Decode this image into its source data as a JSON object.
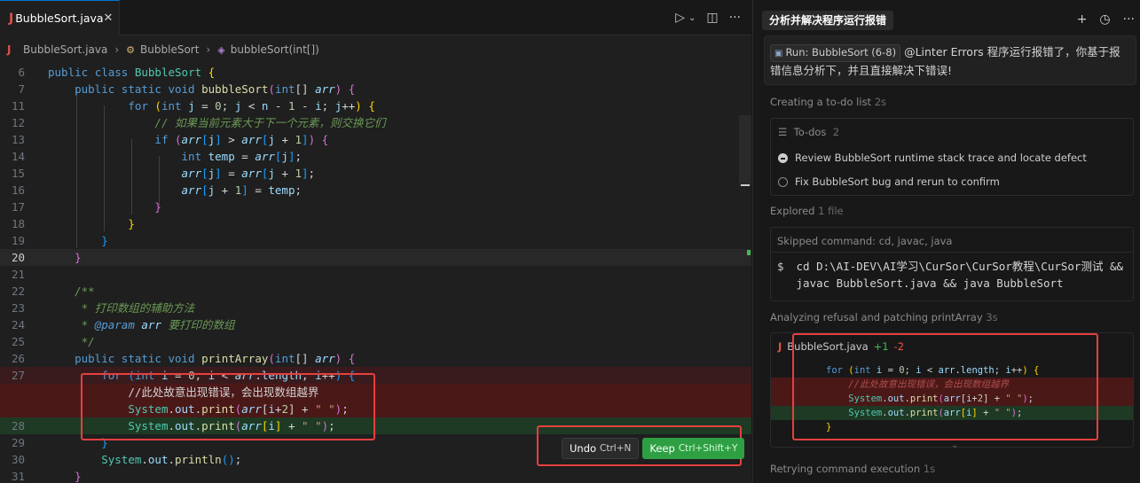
{
  "editor": {
    "tab": {
      "label": "BubbleSort.java",
      "close": "✕"
    },
    "toolbar": {
      "run": "▷",
      "run_dropdown": "⌄",
      "split": "◫",
      "more": "···"
    },
    "breadcrumb": {
      "file": "BubbleSort.java",
      "class": "BubbleSort",
      "method": "bubbleSort(int[])"
    },
    "lines": [
      {
        "n": "6"
      },
      {
        "n": "7"
      },
      {
        "n": "11"
      },
      {
        "n": "12"
      },
      {
        "n": "13"
      },
      {
        "n": "14"
      },
      {
        "n": "15"
      },
      {
        "n": "16"
      },
      {
        "n": "17"
      },
      {
        "n": "18"
      },
      {
        "n": "19"
      },
      {
        "n": "20"
      },
      {
        "n": "21"
      },
      {
        "n": "22"
      },
      {
        "n": "23"
      },
      {
        "n": "24"
      },
      {
        "n": "25"
      },
      {
        "n": "26"
      },
      {
        "n": "27"
      },
      {
        "n": ""
      },
      {
        "n": ""
      },
      {
        "n": "28"
      },
      {
        "n": "29"
      },
      {
        "n": "30"
      },
      {
        "n": "31"
      }
    ],
    "code": {
      "l6": [
        "public",
        "class",
        "BubbleSort",
        "{"
      ],
      "comment_12": "// 如果当前元素大于下一个元素，则交换它们",
      "doc_23": "* 打印数组的辅助方法",
      "doc_24_tag": "@param",
      "doc_24_rest": "要打印的数组",
      "comment_del": "//此处故意出现错误，会出现数组越界"
    },
    "undo": {
      "label": "Undo",
      "shortcut": "Ctrl+N"
    },
    "keep": {
      "label": "Keep",
      "shortcut": "Ctrl+Shift+Y"
    }
  },
  "panel": {
    "title": "分析并解决程序运行报错",
    "actions": {
      "add": "+",
      "history": "◷",
      "more": "···"
    },
    "user_message": {
      "chip": "Run: BubbleSort (6-8)",
      "text": "@Linter Errors 程序运行报错了，你基于报错信息分析下，并且直接解决下错误!"
    },
    "todo_section": {
      "label": "Creating a to-do list",
      "time": "2s"
    },
    "todos": {
      "header": "To-dos",
      "count": "2",
      "items": [
        {
          "text": "Review BubbleSort runtime stack trace and locate defect",
          "done": true
        },
        {
          "text": "Fix BubbleSort bug and rerun to confirm",
          "done": false
        }
      ]
    },
    "explored": {
      "label": "Explored",
      "detail": "1 file"
    },
    "skipped": {
      "header": "Skipped command: cd, javac, java",
      "prompt": "$",
      "command": "cd D:\\AI-DEV\\AI学习\\CurSor\\CurSor教程\\CurSor测试 && javac BubbleSort.java && java BubbleSort"
    },
    "analyzing": {
      "label": "Analyzing refusal and patching printArray",
      "time": "3s"
    },
    "diff": {
      "file": "BubbleSort.java",
      "added": "+1",
      "removed": "-2",
      "lines": [
        {
          "type": "ctx",
          "text": "for (int i = 0; i < arr.length; i++) {"
        },
        {
          "type": "del",
          "text": "    //此处故意出现错误，会出现数组越界"
        },
        {
          "type": "del",
          "text": "    System.out.print(arr[i+2] + \" \");"
        },
        {
          "type": "add",
          "text": "    System.out.print(arr[i] + \" \");"
        },
        {
          "type": "ctx",
          "text": "}"
        }
      ]
    },
    "retrying": {
      "label": "Retrying command execution",
      "time": "1s"
    }
  }
}
